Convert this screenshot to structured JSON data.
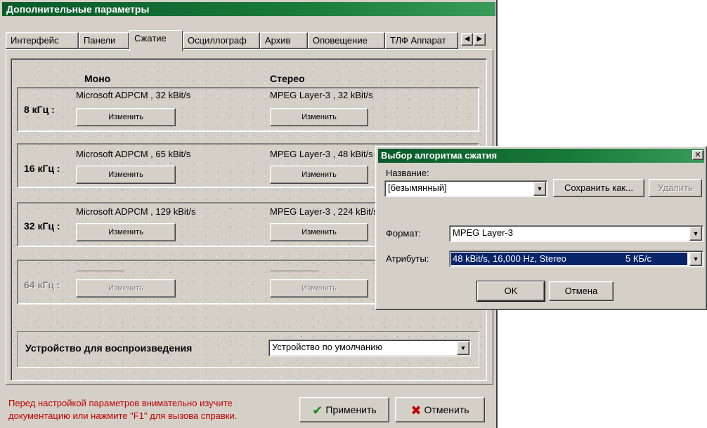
{
  "main_window": {
    "title": "Дополнительные параметры",
    "tabs": [
      "Интерфейс",
      "Панели",
      "Сжатие",
      "Осциллограф",
      "Архив",
      "Оповещение",
      "ТЛФ Аппарат"
    ],
    "active_tab": "Сжатие",
    "columns": {
      "mono": "Моно",
      "stereo": "Стерео"
    },
    "rates": [
      {
        "label": "8 кГц :",
        "mono": "Microsoft ADPCM , 32 kBit/s",
        "stereo": "MPEG Layer-3 , 32 kBit/s",
        "enabled": true
      },
      {
        "label": "16 кГц :",
        "mono": "Microsoft ADPCM , 65 kBit/s",
        "stereo": "MPEG Layer-3 , 48 kBit/s",
        "enabled": true
      },
      {
        "label": "32 кГц :",
        "mono": "Microsoft ADPCM , 129 kBit/s",
        "stereo": "MPEG Layer-3 , 224 kBit/s",
        "enabled": true
      },
      {
        "label": "64 кГц :",
        "mono": "-----------------------",
        "stereo": "-----------------------",
        "enabled": false
      }
    ],
    "change_button": "Изменить",
    "playback_label": "Устройство для воспроизведения",
    "playback_device": "Устройство по умолчанию",
    "footer_note_line1": "Перед настройкой параметров внимательно изучите",
    "footer_note_line2": "документацию или нажмите \"F1\" для вызова справки.",
    "apply_button": "Применить",
    "cancel_button": "Отменить"
  },
  "dialog": {
    "title": "Выбор алгоритма сжатия",
    "name_label": "Название:",
    "name_value": "[безымянный]",
    "save_as_button": "Сохранить как...",
    "delete_button": "Удалить",
    "format_label": "Формат:",
    "format_value": "MPEG Layer-3",
    "attributes_label": "Атрибуты:",
    "attributes_value": "48 kBit/s, 16,000 Hz, Stereo",
    "attributes_size": "5 КБ/с",
    "ok_button": "OK",
    "cancel_button": "Отмена"
  },
  "colors": {
    "titlebar": "#1a7a3a",
    "window": "#d4d0c8",
    "selection": "#0a246a",
    "footer_text": "#c00000"
  }
}
